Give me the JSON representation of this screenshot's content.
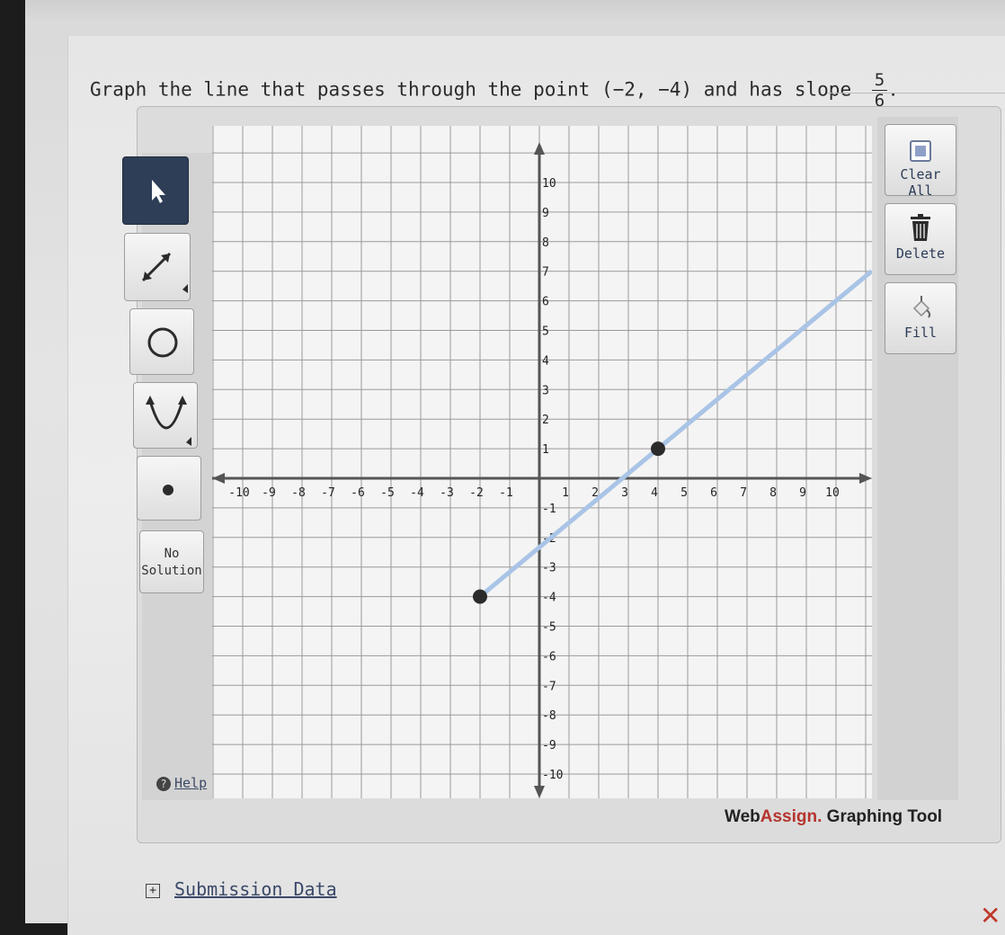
{
  "question": {
    "text": "Graph the line that passes through the point (−2, −4) and has slope",
    "slope_numerator": "5",
    "slope_denominator": "6",
    "trailing": "."
  },
  "toolbar": {
    "no_solution_line1": "No",
    "no_solution_line2": "Solution",
    "help_label": "Help"
  },
  "side_buttons": {
    "clear_all": "Clear All",
    "delete": "Delete",
    "fill": "Fill"
  },
  "brand": {
    "part1": "Web",
    "part2": "Assign.",
    "part3": " Graphing Tool"
  },
  "footer": {
    "submission_label": "Submission Data",
    "expand_symbol": "+",
    "close_symbol": "✕"
  },
  "colors": {
    "line": "#a9c4e6",
    "point": "#2b2b2b",
    "grid": "#9a9a9a",
    "axis": "#555555",
    "active_tool": "#2d3e56"
  },
  "chart_data": {
    "type": "line",
    "xlim": [
      -10,
      10
    ],
    "ylim": [
      -10,
      10
    ],
    "x_tick_labels": [
      "-10",
      "-9",
      "-8",
      "-7",
      "-6",
      "-5",
      "-4",
      "-3",
      "-2",
      "-1",
      "1",
      "2",
      "3",
      "4",
      "5",
      "6",
      "7",
      "8",
      "9",
      "10"
    ],
    "y_tick_labels": [
      "10",
      "9",
      "8",
      "7",
      "6",
      "5",
      "4",
      "3",
      "2",
      "1",
      "-1",
      "-2",
      "-3",
      "-4",
      "-5",
      "-6",
      "-7",
      "-8",
      "-9",
      "-10"
    ],
    "grid": true,
    "points": [
      {
        "x": -2,
        "y": -4
      },
      {
        "x": 4,
        "y": 1
      }
    ],
    "line": {
      "x1": -2,
      "y1": -4,
      "x2": 11.2,
      "y2": 7
    }
  }
}
